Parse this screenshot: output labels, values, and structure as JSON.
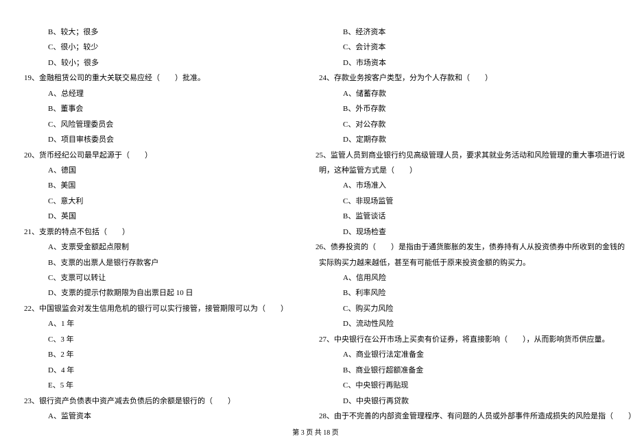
{
  "left": {
    "items": [
      {
        "cls": "opt",
        "text": "B、较大；很多"
      },
      {
        "cls": "opt",
        "text": "C、很小；较少"
      },
      {
        "cls": "opt",
        "text": "D、较小；很多"
      },
      {
        "cls": "q",
        "text": "19、金融租赁公司的重大关联交易应经（　　）批准。"
      },
      {
        "cls": "opt",
        "text": "A、总经理"
      },
      {
        "cls": "opt",
        "text": "B、董事会"
      },
      {
        "cls": "opt",
        "text": "C、风险管理委员会"
      },
      {
        "cls": "opt",
        "text": "D、项目审核委员会"
      },
      {
        "cls": "q",
        "text": "20、货币经纪公司最早起源于（　　）"
      },
      {
        "cls": "opt",
        "text": "A、德国"
      },
      {
        "cls": "opt",
        "text": "B、美国"
      },
      {
        "cls": "opt",
        "text": "C、意大利"
      },
      {
        "cls": "opt",
        "text": "D、英国"
      },
      {
        "cls": "q",
        "text": "21、支票的特点不包括（　　）"
      },
      {
        "cls": "opt",
        "text": "A、支票受金额起点限制"
      },
      {
        "cls": "opt",
        "text": "B、支票的出票人是银行存款客户"
      },
      {
        "cls": "opt",
        "text": "C、支票可以转让"
      },
      {
        "cls": "opt",
        "text": "D、支票的提示付款期限为自出票日起 10 日"
      },
      {
        "cls": "q",
        "text": "22、中国银监会对发生信用危机的银行可以实行接管，接管期限可以为（　　）"
      },
      {
        "cls": "opt",
        "text": "A、1 年"
      },
      {
        "cls": "opt",
        "text": "C、3 年"
      },
      {
        "cls": "opt",
        "text": "B、2 年"
      },
      {
        "cls": "opt",
        "text": "D、4 年"
      },
      {
        "cls": "opt",
        "text": "E、5 年"
      },
      {
        "cls": "q",
        "text": "23、银行资产负债表中资产减去负债后的余额是银行的（　　）"
      },
      {
        "cls": "opt",
        "text": "A、监管资本"
      }
    ]
  },
  "right": {
    "items": [
      {
        "cls": "opt",
        "text": "B、经济资本"
      },
      {
        "cls": "opt",
        "text": "C、会计资本"
      },
      {
        "cls": "opt",
        "text": "D、市场资本"
      },
      {
        "cls": "q",
        "text": "24、存款业务按客户类型，分为个人存款和（　　）"
      },
      {
        "cls": "opt",
        "text": "A、储蓄存款"
      },
      {
        "cls": "opt",
        "text": "B、外币存款"
      },
      {
        "cls": "opt",
        "text": "C、对公存款"
      },
      {
        "cls": "opt",
        "text": "D、定期存款"
      },
      {
        "cls": "q2",
        "text": "25、监管人员到商业银行约见高级管理人员，要求其就业务活动和风险管理的重大事项进行说"
      },
      {
        "cls": "qindent",
        "text": "明，这种监管方式是（　　）"
      },
      {
        "cls": "opt",
        "text": "A、市场准入"
      },
      {
        "cls": "opt",
        "text": "C、非现场监管"
      },
      {
        "cls": "opt",
        "text": "B、监管谈话"
      },
      {
        "cls": "opt",
        "text": "D、现场检查"
      },
      {
        "cls": "q2",
        "text": "26、债券投资的（　　）是指由于通货膨胀的发生，债券持有人从投资债券中所收到的金钱的"
      },
      {
        "cls": "qindent",
        "text": "实际购买力越来越低，甚至有可能低于原来投资金额的购买力。"
      },
      {
        "cls": "opt",
        "text": "A、信用风险"
      },
      {
        "cls": "opt",
        "text": "B、利率风险"
      },
      {
        "cls": "opt",
        "text": "C、购买力风险"
      },
      {
        "cls": "opt",
        "text": "D、流动性风险"
      },
      {
        "cls": "q",
        "text": "27、中央银行在公开市场上买卖有价证券，将直接影响（　　），从而影响货币供应量。"
      },
      {
        "cls": "opt",
        "text": "A、商业银行法定准备金"
      },
      {
        "cls": "opt",
        "text": "B、商业银行超额准备金"
      },
      {
        "cls": "opt",
        "text": "C、中央银行再贴现"
      },
      {
        "cls": "opt",
        "text": "D、中央银行再贷款"
      },
      {
        "cls": "q",
        "text": "28、由于不完善的内部资金管理程序、有问题的人员或外部事件所造成损失的风险是指（　　）"
      }
    ]
  },
  "footer": "第 3 页 共 18 页"
}
